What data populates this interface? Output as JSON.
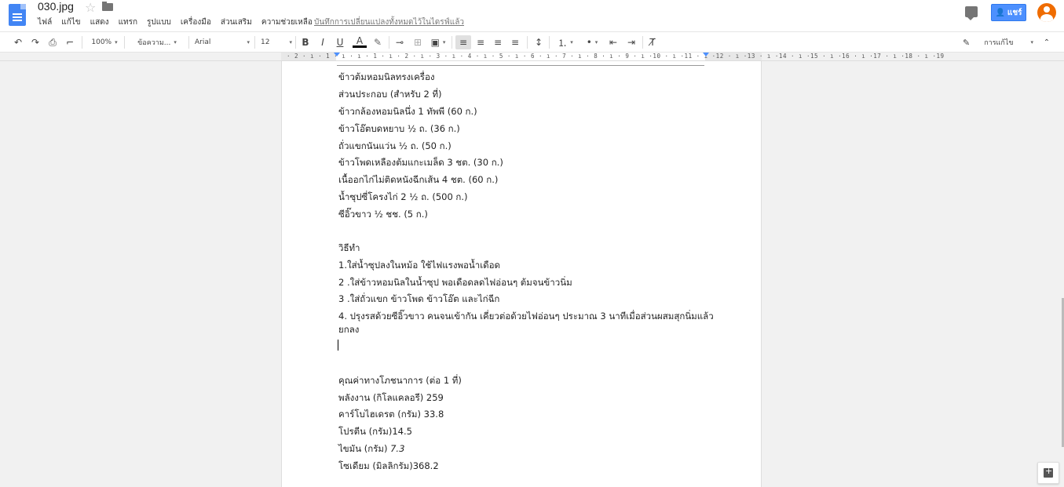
{
  "header": {
    "title": "030.jpg",
    "menus": [
      "ไฟล์",
      "แก้ไข",
      "แสดง",
      "แทรก",
      "รูปแบบ",
      "เครื่องมือ",
      "ส่วนเสริม",
      "ความช่วยเหลือ"
    ],
    "save_status": "บันทึกการเปลี่ยนแปลงทั้งหมดไว้ในไดรฟ์แล้ว",
    "share_label": "แชร์"
  },
  "toolbar": {
    "zoom": "100%",
    "style": "ข้อความ...",
    "font": "Arial",
    "size": "12",
    "editing_mode": "การแก้ไข"
  },
  "ruler": {
    "numbers": "· 2 · ı · 1 · ı · ı · 1 · ı · 2 · ı · 3 · ı · 4 · ı · 5 · ı · 6 · ı · 7 · ı · 8 · ı · 9 · ı ·10 · ı ·11 · ı ·12 · ı ·13 · ı ·14 · ı ·15 · ı ·16 · ı ·17 · ı ·18 · ı ·19"
  },
  "document": {
    "title": "ข้าวต้มหอมนิลทรงเครื่อง",
    "ingredients_heading": "ส่วนประกอบ (สำหรับ 2 ที่)",
    "ingredients": [
      " ข้าวกล้องหอมนิลนึ่ง  1 ทัพพี (60 ก.)",
      "ข้าวโอ๊ตบดหยาบ ½  ถ. (36 ก.)",
      " ถั่วแขกนันแว่น  ½ ถ. (50 ก.)",
      "ข้าวโพดเหลืองต้มแกะเมล็ด 3 ชต. (30 ก.)",
      "เนื้ออกไก่ไม่ติดหนังฉีกเส้น 4 ชต. (60 ก.)",
      "น้ำซุปซี่โครงไก่  2 ½  ถ. (500 ก.)",
      "ซีอิ๊วขาว ½ ชช. (5 ก.)"
    ],
    "method_heading": "วิธีทำ",
    "steps": [
      "1.ใส่น้ำซุปลงในหม้อ ใช้ไฟแรงพอน้ำเดือด",
      "2 .ใส่ข้าวหอมนิลในน้ำซุป พอเดือดลดไฟอ่อนๆ ต้มจนข้าวนิ่ม",
      "3 .ใส่ถั่วแขก ข้าวโพด ข้าวโอ๊ต และไก่ฉีก",
      "4. ปรุงรสด้วยซีอิ๊วขาว คนจนเข้ากัน เคี่ยวต่อด้วยไฟอ่อนๆ ประมาณ 3 นาทีเมื่อส่วนผสมสุกนิ่มแล้ว",
      "ยกลง"
    ],
    "nutrition_heading": "คุณค่าทางโภชนาการ (ต่อ 1 ที่)",
    "nutrition": [
      {
        "label": "พลังงาน (กิโลแคลอรี) 259",
        "italic": ""
      },
      {
        "label": "คาร์โบไฮเดรต (กรัม) 33.8",
        "italic": ""
      },
      {
        "label": "โปรตีน (กรัม)14.5",
        "italic": ""
      },
      {
        "label": "ไขมัน (กรัม) ",
        "italic": "7.3"
      },
      {
        "label": "โซเดียม (มิลลิกรัม)368.2",
        "italic": ""
      }
    ]
  }
}
